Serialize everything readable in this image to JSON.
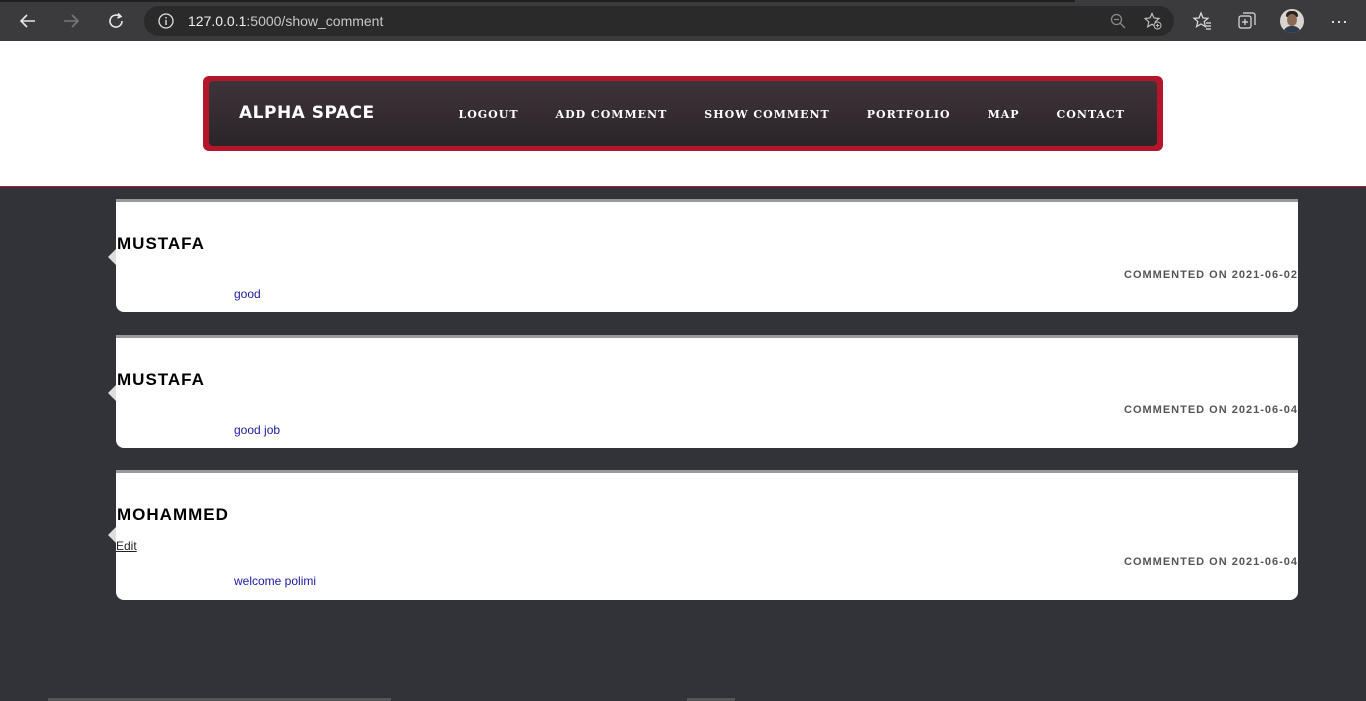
{
  "browser": {
    "url_host": "127.0.0.1",
    "url_rest": ":5000/show_comment"
  },
  "site": {
    "brand": "ALPHA SPACE",
    "menu": [
      {
        "label": "LOGOUT"
      },
      {
        "label": "ADD COMMENT"
      },
      {
        "label": "SHOW COMMENT"
      },
      {
        "label": "PORTFOLIO"
      },
      {
        "label": "MAP"
      },
      {
        "label": "CONTACT"
      }
    ]
  },
  "comments": [
    {
      "author": "MUSTAFA",
      "date": "COMMENTED ON 2021-06-02",
      "text": "good"
    },
    {
      "author": "MUSTAFA",
      "date": "COMMENTED ON 2021-06-04",
      "text": "good job"
    },
    {
      "author": "MOHAMMED",
      "edit": "Edit",
      "date": "COMMENTED ON 2021-06-04",
      "text": "welcome polimi"
    }
  ],
  "colors": {
    "accent": "#b3162a",
    "page_bg": "#323338",
    "comment_text": "#1a1aa6"
  }
}
